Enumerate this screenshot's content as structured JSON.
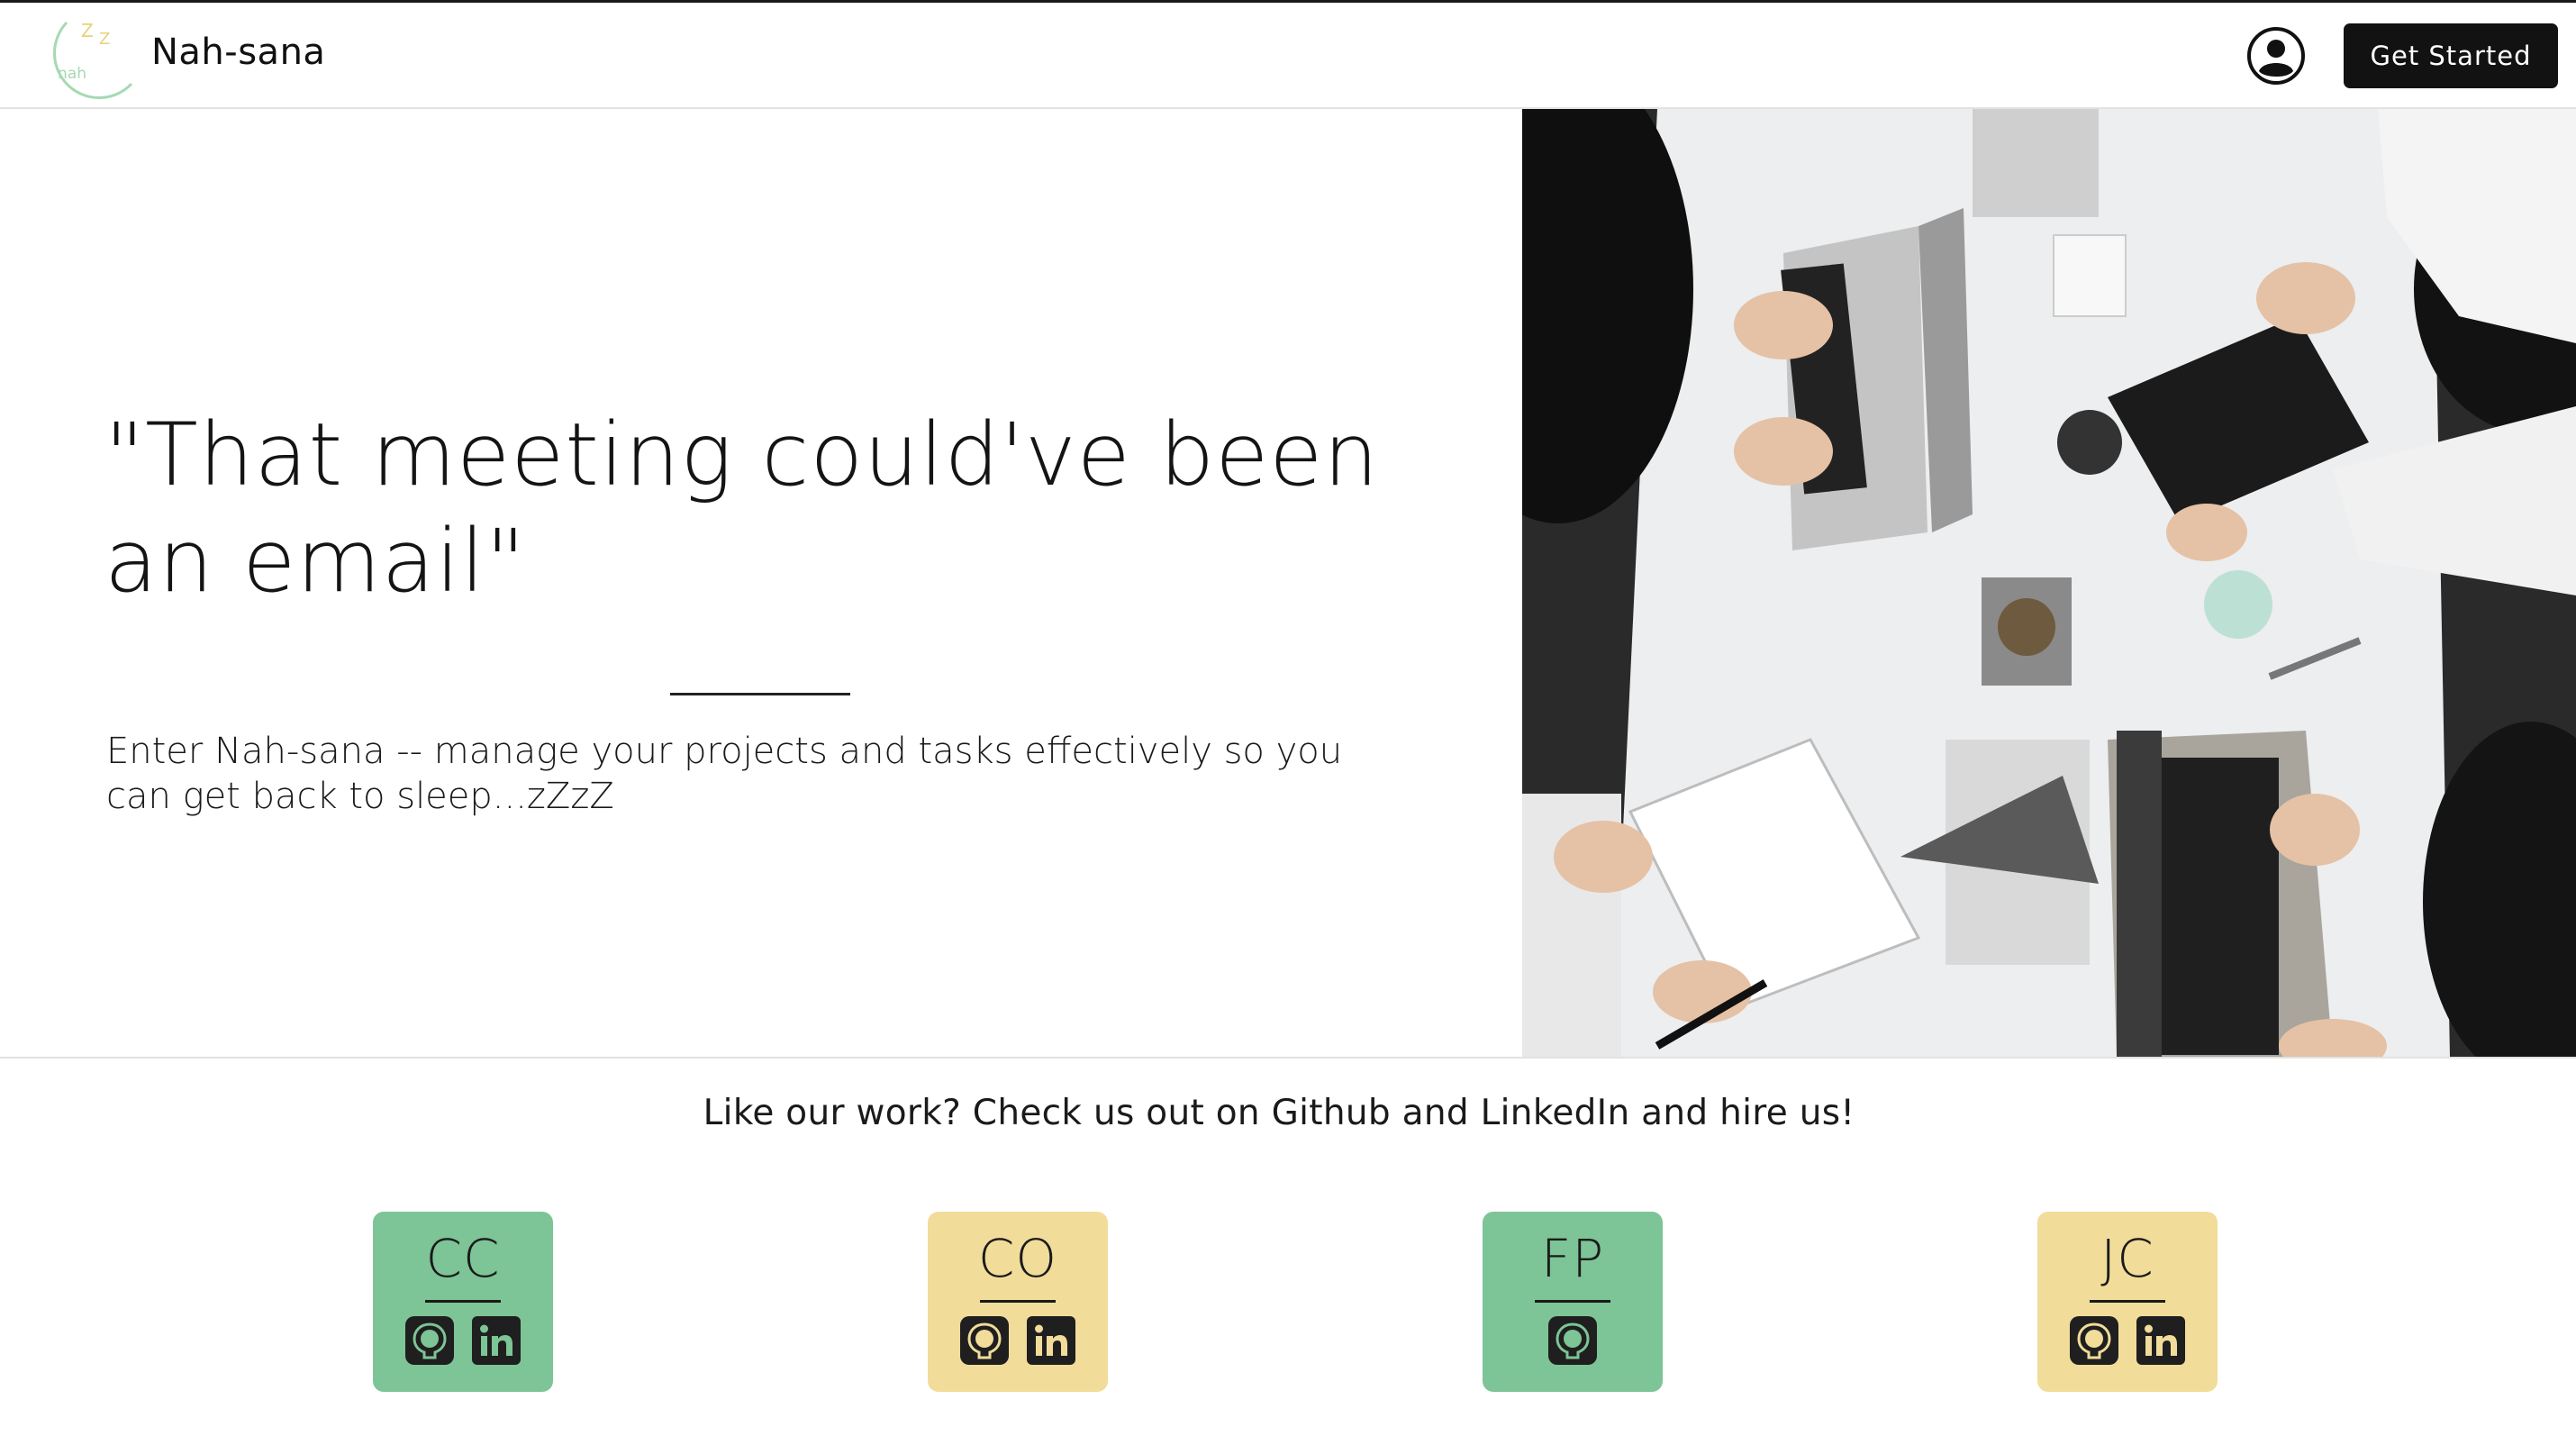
{
  "nav": {
    "brand": "Nah-sana",
    "logo_text": "nah",
    "logo_zzz": "Z Z",
    "get_started_label": "Get Started"
  },
  "hero": {
    "quote": "\"That meeting could've been an email\"",
    "tagline": "Enter Nah-sana -- manage your projects and tasks effectively so you can get back to sleep...zZzZ",
    "photo_alt": "overhead view of a team working at a white table with laptops"
  },
  "footer": {
    "cta": "Like our work? Check us out on Github and LinkedIn and hire us!",
    "team": [
      {
        "initials": "CC",
        "color": "green",
        "links": [
          "github",
          "linkedin"
        ]
      },
      {
        "initials": "CO",
        "color": "yellow",
        "links": [
          "github",
          "linkedin"
        ]
      },
      {
        "initials": "FP",
        "color": "green",
        "links": [
          "github"
        ]
      },
      {
        "initials": "JC",
        "color": "yellow",
        "links": [
          "github",
          "linkedin"
        ]
      }
    ]
  },
  "colors": {
    "green_card": "#7dc496",
    "yellow_card": "#f1dc9a",
    "button_dark": "#121212",
    "logo_moon": "#a6d9b3",
    "logo_z": "#e7d27c"
  }
}
